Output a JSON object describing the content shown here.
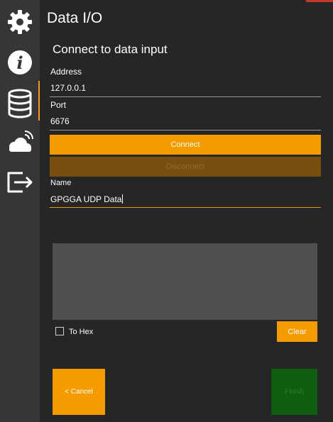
{
  "window": {
    "accent_color": "#c0392b"
  },
  "sidebar": {
    "items": [
      {
        "icon": "gear-icon"
      },
      {
        "icon": "info-icon"
      },
      {
        "icon": "database-icon",
        "active": true
      },
      {
        "icon": "cloud-signal-icon"
      },
      {
        "icon": "export-icon"
      }
    ],
    "active_color": "#f39c12"
  },
  "page": {
    "title": "Data I/O",
    "subtitle": "Connect to data input"
  },
  "form": {
    "address": {
      "label": "Address",
      "value": "127.0.0.1"
    },
    "port": {
      "label": "Port",
      "value": "6676"
    },
    "connect_label": "Connect",
    "disconnect_label": "Disconnect",
    "name": {
      "label": "Name",
      "value": "GPGGA UDP Data"
    }
  },
  "data_view": {
    "to_hex_label": "To Hex",
    "to_hex_checked": false,
    "clear_label": "Clear"
  },
  "footer": {
    "cancel_label": "< Cancel",
    "finish_label": "Finish"
  },
  "colors": {
    "accent": "#f59b00",
    "disabled_accent": "#7a4e0f",
    "finish_disabled": "#0f5e0f",
    "background": "#262626",
    "sidebar": "#363636"
  }
}
